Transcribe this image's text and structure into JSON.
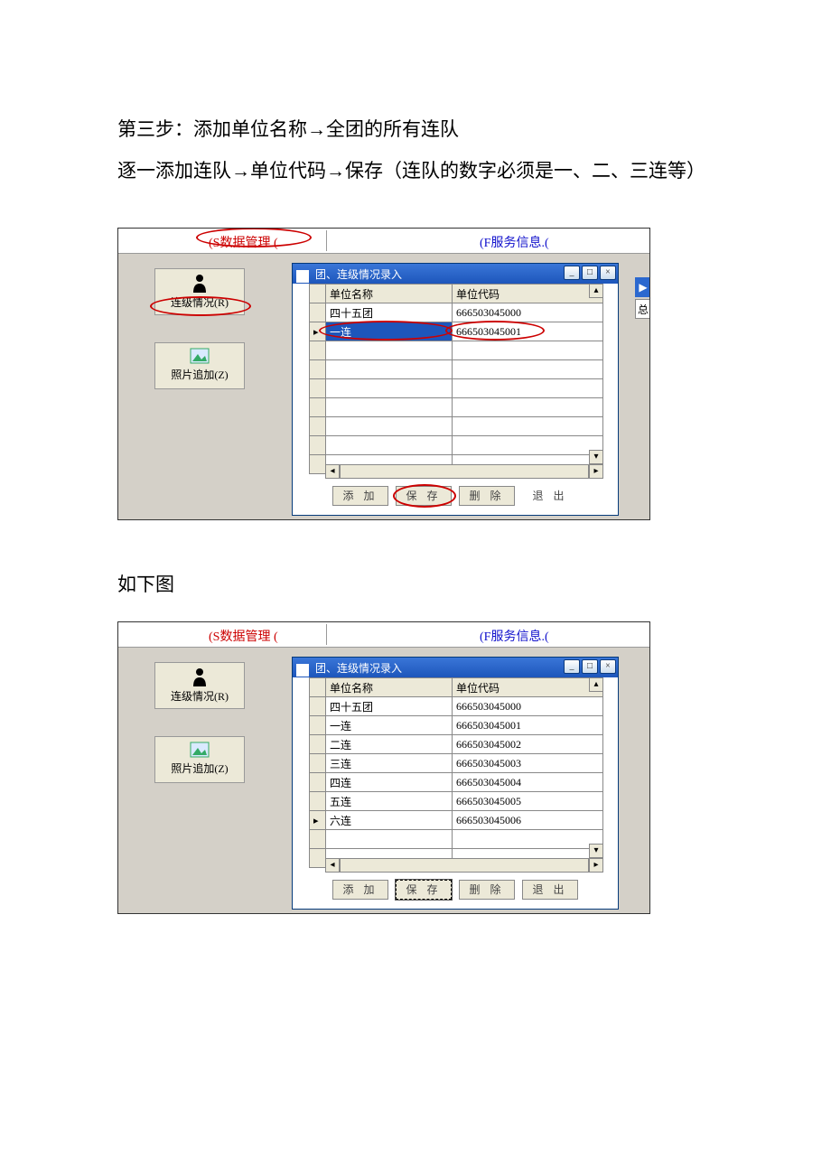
{
  "text": {
    "paragraph1": "第三步：添加单位名称→全团的所有连队",
    "paragraph2": "逐一添加连队→单位代码→保存（连队的数字必须是一、二、三连等）",
    "label_below": "如下图"
  },
  "shared": {
    "menu": {
      "data_mgmt": "(S数据管理 (",
      "service_info": "(F服务信息.("
    },
    "sidebar": {
      "btn1_label": "连级情况(R)",
      "btn2_label": "照片追加(Z)"
    },
    "window": {
      "title": "团、连级情况录入",
      "col_name": "单位名称",
      "col_code": "单位代码",
      "buttons": {
        "add": "添 加",
        "save": "保 存",
        "del": "删 除",
        "exit": "退 出"
      }
    },
    "side_tab2": "总"
  },
  "screenshot1": {
    "rows": [
      {
        "name": "四十五团",
        "code": "666503045000",
        "indicator": "",
        "selected": false
      },
      {
        "name": "一连",
        "code": "666503045001",
        "indicator": "▸",
        "selected": true
      }
    ]
  },
  "screenshot2": {
    "rows": [
      {
        "name": "四十五团",
        "code": "666503045000",
        "indicator": ""
      },
      {
        "name": "一连",
        "code": "666503045001",
        "indicator": ""
      },
      {
        "name": "二连",
        "code": "666503045002",
        "indicator": ""
      },
      {
        "name": "三连",
        "code": "666503045003",
        "indicator": ""
      },
      {
        "name": "四连",
        "code": "666503045004",
        "indicator": ""
      },
      {
        "name": "五连",
        "code": "666503045005",
        "indicator": ""
      },
      {
        "name": "六连",
        "code": "666503045006",
        "indicator": "▸"
      }
    ]
  }
}
